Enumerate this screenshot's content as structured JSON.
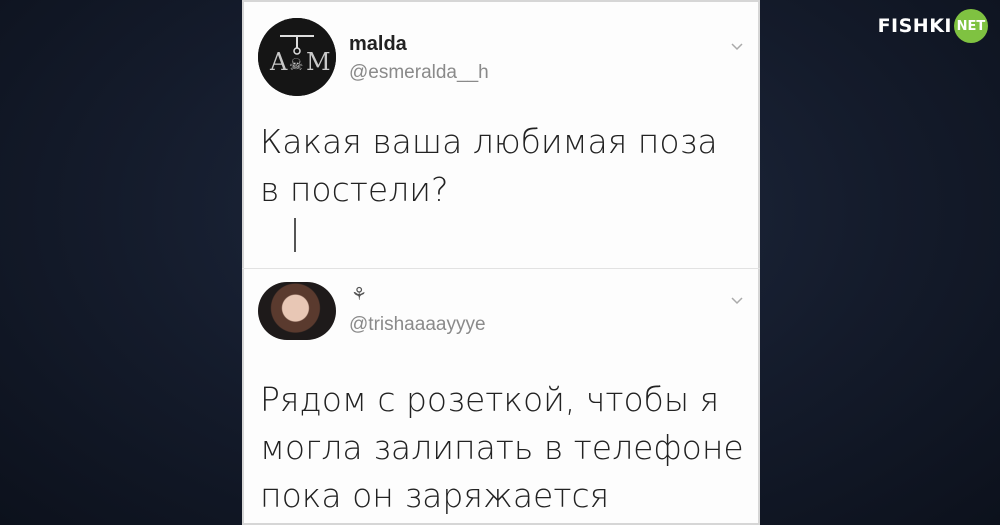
{
  "watermark": {
    "text": "FISHKI",
    "badge": "NET"
  },
  "tweets": [
    {
      "username": "malda",
      "handle": "@esmeralda__h",
      "text": "Какая ваша любимая поза в постели?",
      "avatar_letters": "A M"
    },
    {
      "display_name": "⚘",
      "handle": "@trishaaaayyye",
      "text": "Рядом с розеткой, чтобы я могла залипать в телефоне пока он заряжается"
    }
  ],
  "colors": {
    "card_bg": "#fdfdfd",
    "handle_gray": "#8a8a8a",
    "badge_green": "#7fc241"
  }
}
